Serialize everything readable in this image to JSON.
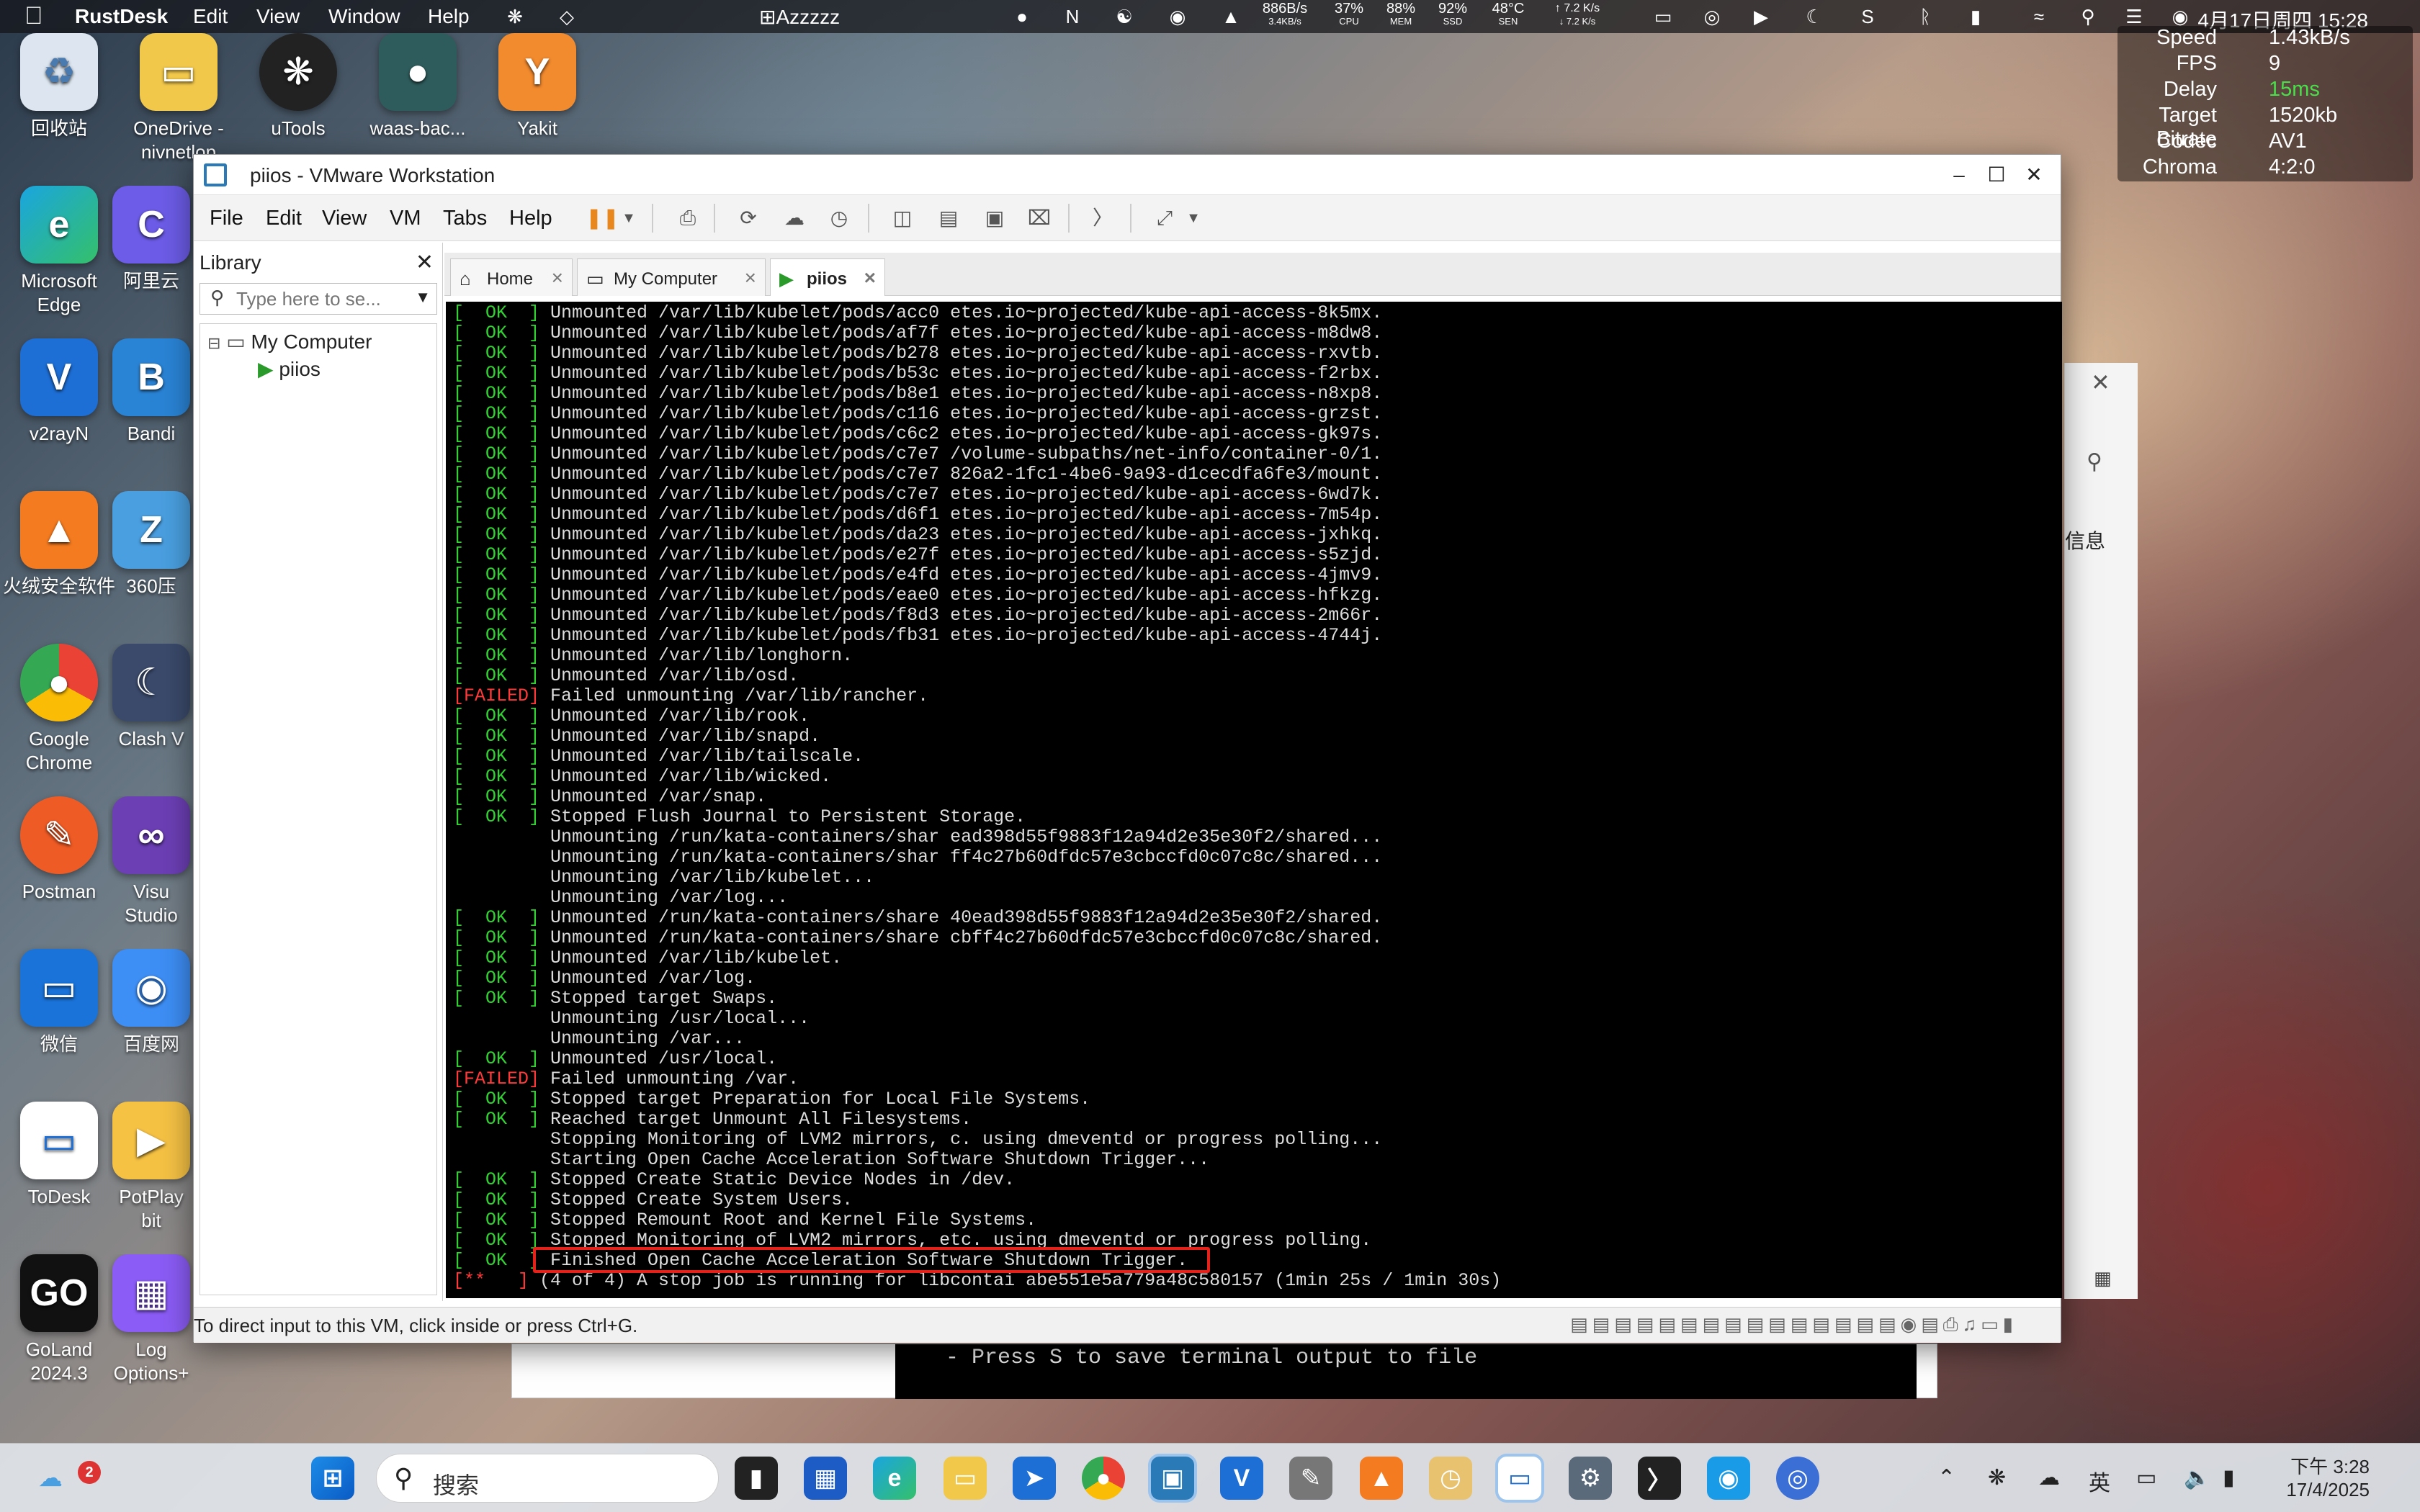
{
  "menubar": {
    "app": "RustDesk",
    "items": [
      "Edit",
      "View",
      "Window",
      "Help"
    ],
    "center_label": "⊞Azzzzz",
    "net_up": "886B/s",
    "net_down": "3.4KB/s",
    "cpu_val": "37%",
    "cpu_lbl": "CPU",
    "mem_val": "88%",
    "mem_lbl": "MEM",
    "ssd_val": "92%",
    "ssd_lbl": "SSD",
    "sen_val": "48°C",
    "sen_lbl": "SEN",
    "speed_up": "↑ 7.2 K/s",
    "speed_down": "↓ 7.2 K/s",
    "clock": "4月17日周四  15:28"
  },
  "rustdesk_stats": [
    {
      "k": "Speed",
      "v": "1.43kB/s"
    },
    {
      "k": "FPS",
      "v": "9"
    },
    {
      "k": "Delay",
      "v": "15ms"
    },
    {
      "k": "Target Bitrate",
      "v": "1520kb"
    },
    {
      "k": "Codec",
      "v": "AV1"
    },
    {
      "k": "Chroma",
      "v": "4:2:0"
    }
  ],
  "desktop_icons": [
    {
      "label": "回收站"
    },
    {
      "label": "OneDrive - nivnetlop"
    },
    {
      "label": "uTools"
    },
    {
      "label": "waas-bac..."
    },
    {
      "label": "Yakit"
    },
    {
      "label": "Microsoft Edge"
    },
    {
      "label": "阿里云"
    },
    {
      "label": "v2rayN"
    },
    {
      "label": "Bandi"
    },
    {
      "label": "火绒安全软件"
    },
    {
      "label": "360压"
    },
    {
      "label": "Google Chrome"
    },
    {
      "label": "Clash V"
    },
    {
      "label": "Postman"
    },
    {
      "label": "Visu Studio"
    },
    {
      "label": "微信"
    },
    {
      "label": "百度网"
    },
    {
      "label": "ToDesk"
    },
    {
      "label": "PotPlay bit"
    },
    {
      "label": "GoLand 2024.3"
    },
    {
      "label": "Log Options+"
    }
  ],
  "vm_window": {
    "title": "piios - VMware Workstation",
    "menu": [
      "File",
      "Edit",
      "View",
      "VM",
      "Tabs",
      "Help"
    ],
    "library_title": "Library",
    "search_placeholder": "Type here to se...",
    "tree_root": "My Computer",
    "tree_child": "piios",
    "tabs": [
      "Home",
      "My Computer",
      "piios"
    ],
    "status_msg": "To direct input to this VM, click inside or press Ctrl+G."
  },
  "console_lines": [
    {
      "s": "[  OK  ]",
      "t": "ok",
      "m": " Unmounted /var/lib/kubelet/pods/acc0 etes.io~projected/kube-api-access-8k5mx."
    },
    {
      "s": "[  OK  ]",
      "t": "ok",
      "m": " Unmounted /var/lib/kubelet/pods/af7f etes.io~projected/kube-api-access-m8dw8."
    },
    {
      "s": "[  OK  ]",
      "t": "ok",
      "m": " Unmounted /var/lib/kubelet/pods/b278 etes.io~projected/kube-api-access-rxvtb."
    },
    {
      "s": "[  OK  ]",
      "t": "ok",
      "m": " Unmounted /var/lib/kubelet/pods/b53c etes.io~projected/kube-api-access-f2rbx."
    },
    {
      "s": "[  OK  ]",
      "t": "ok",
      "m": " Unmounted /var/lib/kubelet/pods/b8e1 etes.io~projected/kube-api-access-n8xp8."
    },
    {
      "s": "[  OK  ]",
      "t": "ok",
      "m": " Unmounted /var/lib/kubelet/pods/c116 etes.io~projected/kube-api-access-grzst."
    },
    {
      "s": "[  OK  ]",
      "t": "ok",
      "m": " Unmounted /var/lib/kubelet/pods/c6c2 etes.io~projected/kube-api-access-gk97s."
    },
    {
      "s": "[  OK  ]",
      "t": "ok",
      "m": " Unmounted /var/lib/kubelet/pods/c7e7 /volume-subpaths/net-info/container-0/1."
    },
    {
      "s": "[  OK  ]",
      "t": "ok",
      "m": " Unmounted /var/lib/kubelet/pods/c7e7 826a2-1fc1-4be6-9a93-d1cecdfa6fe3/mount."
    },
    {
      "s": "[  OK  ]",
      "t": "ok",
      "m": " Unmounted /var/lib/kubelet/pods/c7e7 etes.io~projected/kube-api-access-6wd7k."
    },
    {
      "s": "[  OK  ]",
      "t": "ok",
      "m": " Unmounted /var/lib/kubelet/pods/d6f1 etes.io~projected/kube-api-access-7m54p."
    },
    {
      "s": "[  OK  ]",
      "t": "ok",
      "m": " Unmounted /var/lib/kubelet/pods/da23 etes.io~projected/kube-api-access-jxhkq."
    },
    {
      "s": "[  OK  ]",
      "t": "ok",
      "m": " Unmounted /var/lib/kubelet/pods/e27f etes.io~projected/kube-api-access-s5zjd."
    },
    {
      "s": "[  OK  ]",
      "t": "ok",
      "m": " Unmounted /var/lib/kubelet/pods/e4fd etes.io~projected/kube-api-access-4jmv9."
    },
    {
      "s": "[  OK  ]",
      "t": "ok",
      "m": " Unmounted /var/lib/kubelet/pods/eae0 etes.io~projected/kube-api-access-hfkzg."
    },
    {
      "s": "[  OK  ]",
      "t": "ok",
      "m": " Unmounted /var/lib/kubelet/pods/f8d3 etes.io~projected/kube-api-access-2m66r."
    },
    {
      "s": "[  OK  ]",
      "t": "ok",
      "m": " Unmounted /var/lib/kubelet/pods/fb31 etes.io~projected/kube-api-access-4744j."
    },
    {
      "s": "[  OK  ]",
      "t": "ok",
      "m": " Unmounted /var/lib/longhorn."
    },
    {
      "s": "[  OK  ]",
      "t": "ok",
      "m": " Unmounted /var/lib/osd."
    },
    {
      "s": "[FAILED]",
      "t": "failed",
      "m": " Failed unmounting /var/lib/rancher."
    },
    {
      "s": "[  OK  ]",
      "t": "ok",
      "m": " Unmounted /var/lib/rook."
    },
    {
      "s": "[  OK  ]",
      "t": "ok",
      "m": " Unmounted /var/lib/snapd."
    },
    {
      "s": "[  OK  ]",
      "t": "ok",
      "m": " Unmounted /var/lib/tailscale."
    },
    {
      "s": "[  OK  ]",
      "t": "ok",
      "m": " Unmounted /var/lib/wicked."
    },
    {
      "s": "[  OK  ]",
      "t": "ok",
      "m": " Unmounted /var/snap."
    },
    {
      "s": "[  OK  ]",
      "t": "ok",
      "m": " Stopped Flush Journal to Persistent Storage."
    },
    {
      "s": "        ",
      "t": "none",
      "m": " Unmounting /run/kata-containers/shar ead398d55f9883f12a94d2e35e30f2/shared..."
    },
    {
      "s": "        ",
      "t": "none",
      "m": " Unmounting /run/kata-containers/shar ff4c27b60dfdc57e3cbccfd0c07c8c/shared..."
    },
    {
      "s": "        ",
      "t": "none",
      "m": " Unmounting /var/lib/kubelet..."
    },
    {
      "s": "        ",
      "t": "none",
      "m": " Unmounting /var/log..."
    },
    {
      "s": "[  OK  ]",
      "t": "ok",
      "m": " Unmounted /run/kata-containers/share 40ead398d55f9883f12a94d2e35e30f2/shared."
    },
    {
      "s": "[  OK  ]",
      "t": "ok",
      "m": " Unmounted /run/kata-containers/share cbff4c27b60dfdc57e3cbccfd0c07c8c/shared."
    },
    {
      "s": "[  OK  ]",
      "t": "ok",
      "m": " Unmounted /var/lib/kubelet."
    },
    {
      "s": "[  OK  ]",
      "t": "ok",
      "m": " Unmounted /var/log."
    },
    {
      "s": "[  OK  ]",
      "t": "ok",
      "m": " Stopped target Swaps."
    },
    {
      "s": "        ",
      "t": "none",
      "m": " Unmounting /usr/local..."
    },
    {
      "s": "        ",
      "t": "none",
      "m": " Unmounting /var..."
    },
    {
      "s": "[  OK  ]",
      "t": "ok",
      "m": " Unmounted /usr/local."
    },
    {
      "s": "[FAILED]",
      "t": "failed",
      "m": " Failed unmounting /var."
    },
    {
      "s": "[  OK  ]",
      "t": "ok",
      "m": " Stopped target Preparation for Local File Systems."
    },
    {
      "s": "[  OK  ]",
      "t": "ok",
      "m": " Reached target Unmount All Filesystems."
    },
    {
      "s": "        ",
      "t": "none",
      "m": " Stopping Monitoring of LVM2 mirrors, c. using dmeventd or progress polling..."
    },
    {
      "s": "        ",
      "t": "none",
      "m": " Starting Open Cache Acceleration Software Shutdown Trigger..."
    },
    {
      "s": "[  OK  ]",
      "t": "ok",
      "m": " Stopped Create Static Device Nodes in /dev."
    },
    {
      "s": "[  OK  ]",
      "t": "ok",
      "m": " Stopped Create System Users."
    },
    {
      "s": "[  OK  ]",
      "t": "ok",
      "m": " Stopped Remount Root and Kernel File Systems."
    },
    {
      "s": "[  OK  ]",
      "t": "ok",
      "m": " Stopped Monitoring of LVM2 mirrors, etc. using dmeventd or progress polling."
    },
    {
      "s": "[  OK  ]",
      "t": "ok",
      "m": " Finished Open Cache Acceleration Software Shutdown Trigger."
    },
    {
      "s": "[**   ]",
      "t": "red",
      "m": " (4 of 4) A stop job is running for libcontai abe551e5a779a48c580157 (1min 25s / 1min 30s)"
    }
  ],
  "bg_terminal_text": "- Press S to save terminal output to file",
  "taskbar": {
    "search_text": "搜索",
    "weather_badge": "2",
    "ime": "英",
    "time": "下午 3:28",
    "date": "17/4/2025"
  },
  "side_panel_text": "信息",
  "colors": {
    "ok": "#32d232",
    "failed": "#ff3838",
    "highlight": "#e8201a"
  }
}
